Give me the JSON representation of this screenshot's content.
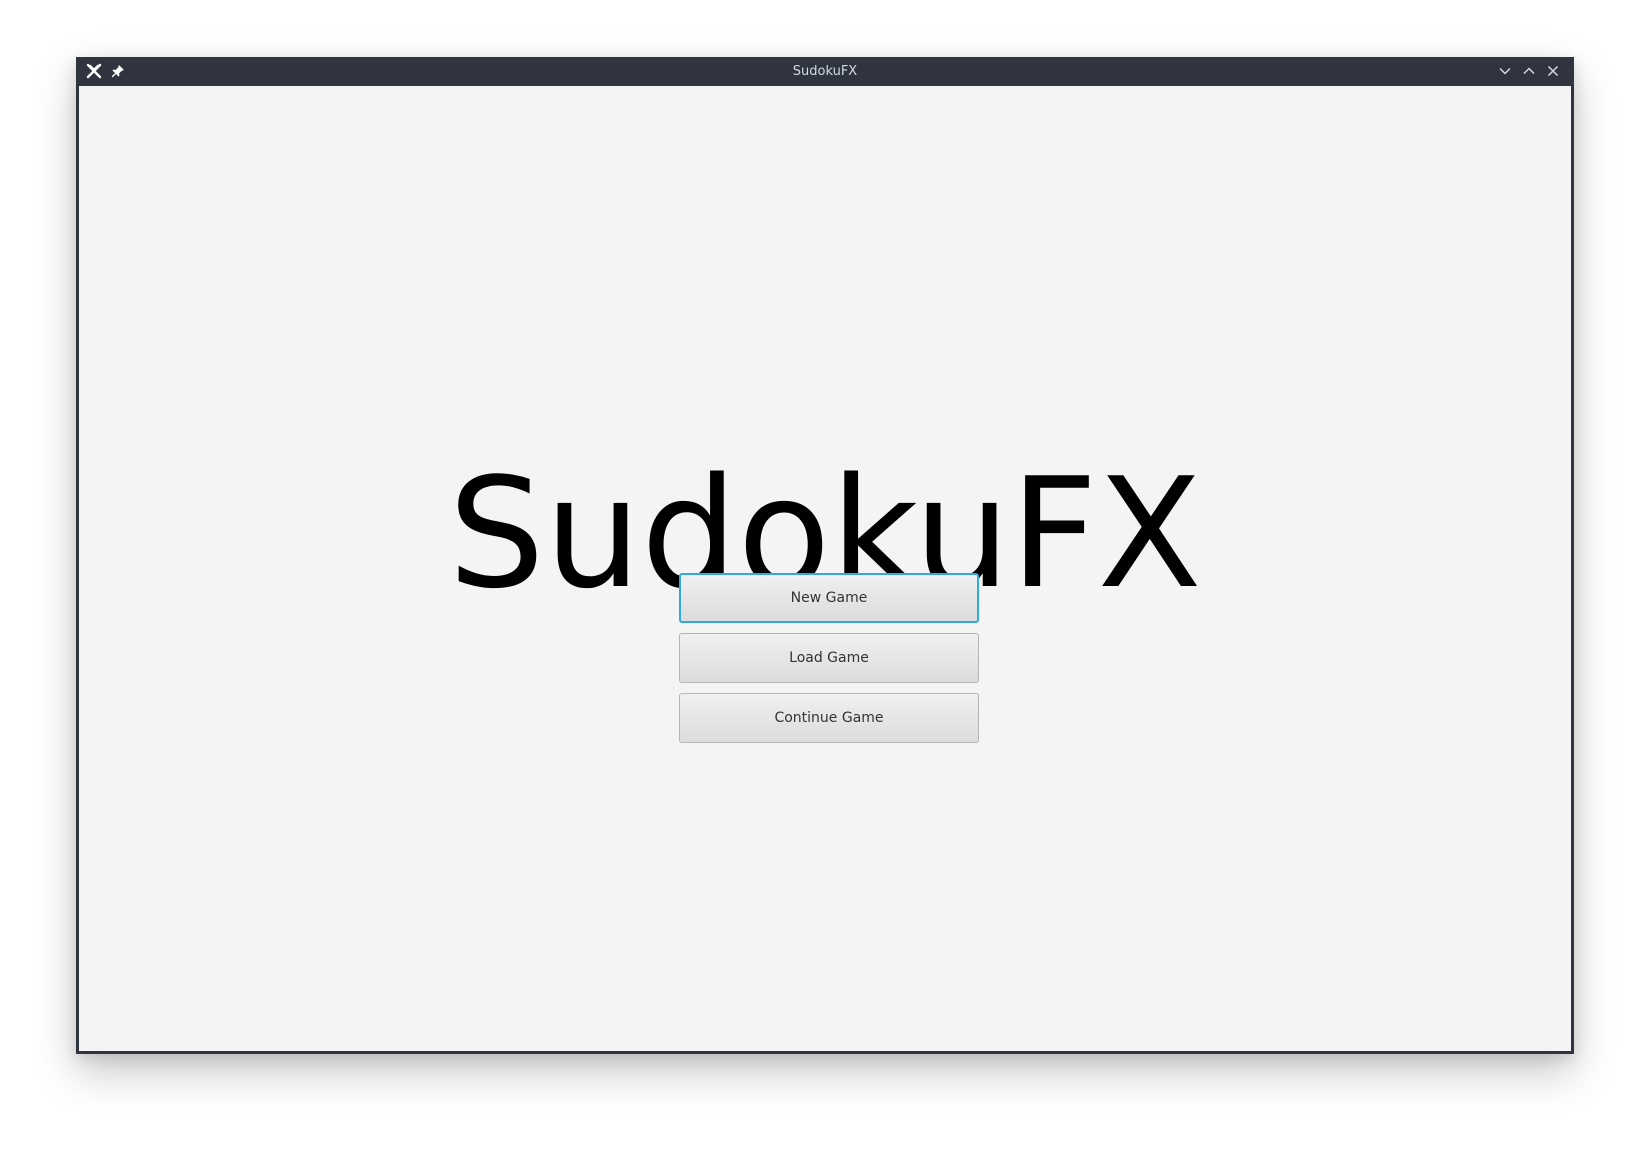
{
  "window": {
    "title": "SudokuFX",
    "titlebar_color": "#2f343f",
    "background_color": "#f4f4f4",
    "icons": {
      "app": "app-x-icon",
      "pin": "pin-icon",
      "minimize": "chevron-down-icon",
      "maximize": "chevron-up-icon",
      "close": "close-icon"
    }
  },
  "main": {
    "heading": "SudokuFX",
    "buttons": {
      "new_game": "New Game",
      "load_game": "Load Game",
      "continue_game": "Continue Game"
    },
    "focus_color": "#2fa9df"
  }
}
